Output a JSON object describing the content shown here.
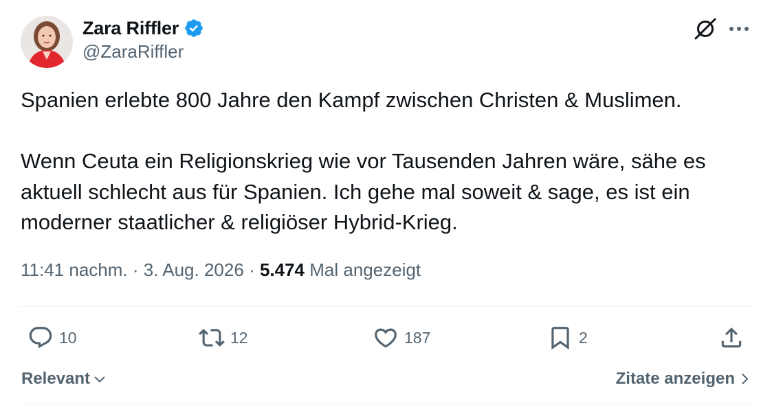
{
  "author": {
    "display_name": "Zara Riffler",
    "handle": "@ZaraRiffler",
    "verified": true,
    "avatar_icon": "profile-photo-woman-red-jacket"
  },
  "header_actions": {
    "grok_icon": "grok-icon",
    "more_icon": "more-dots-icon"
  },
  "tweet": {
    "paragraph1": "Spanien erlebte 800 Jahre den Kampf zwischen Christen & Muslimen.",
    "paragraph2": "Wenn Ceuta ein Religionskrieg wie vor Tausenden Jahren wäre, sähe es aktuell schlecht aus für Spanien. Ich gehe mal soweit & sage, es ist ein moderner staatlicher & religiöser Hybrid-Krieg."
  },
  "meta": {
    "time": "11:41 nachm.",
    "separator": "·",
    "date": "3. Aug. 2026",
    "views_count": "5.474",
    "views_label": "Mal angezeigt"
  },
  "actions": {
    "replies": "10",
    "retweets": "12",
    "likes": "187",
    "bookmarks": "2"
  },
  "footer": {
    "sort_label": "Relevant",
    "quotes_label": "Zitate anzeigen"
  },
  "colors": {
    "text_primary": "#0f1419",
    "text_secondary": "#536471",
    "verified_blue": "#1d9bf0",
    "divider": "#eff3f4"
  }
}
